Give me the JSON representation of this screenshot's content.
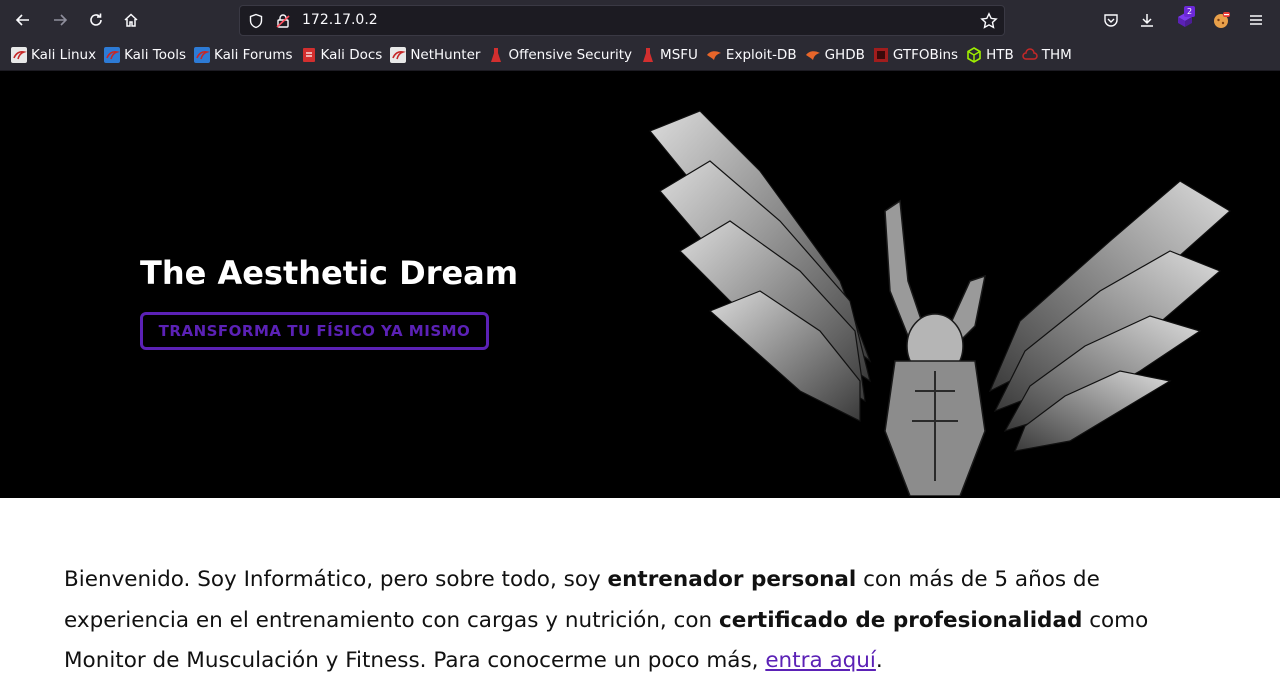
{
  "browser": {
    "url": "172.17.0.2",
    "extension_badge": "2"
  },
  "bookmarks": [
    {
      "label": "Kali Linux",
      "icon": "kali-dragon-icon",
      "color": "#e8e8e8"
    },
    {
      "label": "Kali Tools",
      "icon": "kali-dragon-icon",
      "color": "#2d7bd6"
    },
    {
      "label": "Kali Forums",
      "icon": "kali-dragon-icon",
      "color": "#2d7bd6"
    },
    {
      "label": "Kali Docs",
      "icon": "docs-icon",
      "color": "#d32f2f"
    },
    {
      "label": "NetHunter",
      "icon": "kali-dragon-icon",
      "color": "#e8e8e8"
    },
    {
      "label": "Offensive Security",
      "icon": "offsec-icon",
      "color": "#d32f2f"
    },
    {
      "label": "MSFU",
      "icon": "offsec-icon",
      "color": "#d32f2f"
    },
    {
      "label": "Exploit-DB",
      "icon": "exploit-db-icon",
      "color": "#e8662a"
    },
    {
      "label": "GHDB",
      "icon": "exploit-db-icon",
      "color": "#e8662a"
    },
    {
      "label": "GTFOBins",
      "icon": "gtfobins-icon",
      "color": "#a11d1d"
    },
    {
      "label": "HTB",
      "icon": "htb-cube-icon",
      "color": "#9fef00"
    },
    {
      "label": "THM",
      "icon": "thm-cloud-icon",
      "color": "#c62828"
    }
  ],
  "hero": {
    "title": "The Aesthetic Dream",
    "cta": "TRANSFORMA TU FÍSICO YA MISMO"
  },
  "intro": {
    "t1": "Bienvenido. Soy Informático, pero sobre todo, soy ",
    "b1": "entrenador personal",
    "t2": " con más de 5 años de experiencia en el entrenamiento con cargas y nutrición, con ",
    "b2": "certificado de profesionalidad",
    "t3": " como Monitor de Musculación y Fitness. Para conocerme un poco más, ",
    "link": "entra aquí",
    "t4": "."
  },
  "colors": {
    "accent": "#5b21b6",
    "toolbar": "#2b2a33",
    "hero_bg": "#000000"
  }
}
